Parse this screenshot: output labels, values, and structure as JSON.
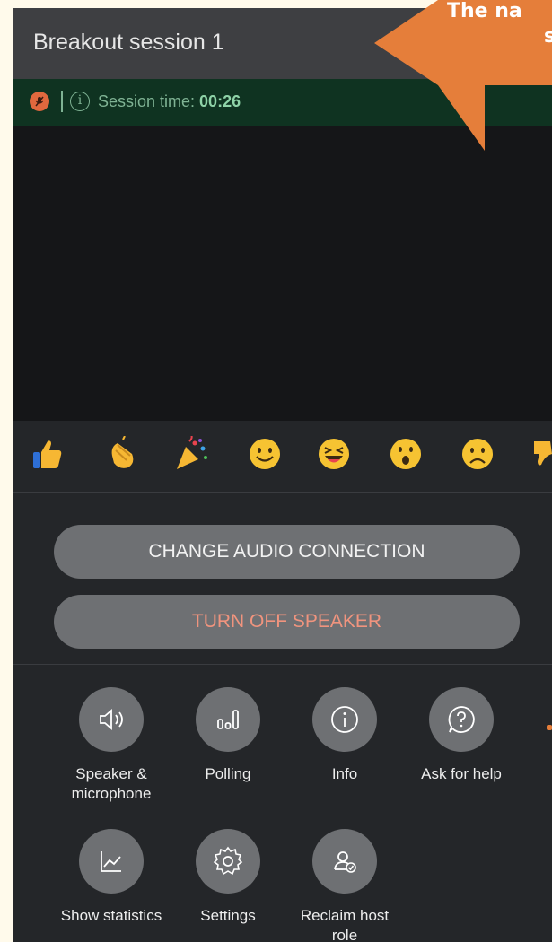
{
  "header": {
    "title": "Breakout session 1"
  },
  "status": {
    "session_label": "Session time: ",
    "session_time": "00:26"
  },
  "reactions": [
    {
      "icon": "thumbs-up-icon"
    },
    {
      "icon": "clapping-hands-icon"
    },
    {
      "icon": "party-popper-icon"
    },
    {
      "icon": "smiling-face-icon"
    },
    {
      "icon": "laughing-face-icon"
    },
    {
      "icon": "surprised-face-icon"
    },
    {
      "icon": "frowning-face-icon"
    },
    {
      "icon": "thumbs-down-icon"
    }
  ],
  "buttons": {
    "change_audio": "CHANGE AUDIO CONNECTION",
    "turn_off_speaker": "TURN OFF SPEAKER"
  },
  "actions": [
    {
      "label": "Speaker & microphone",
      "icon": "speaker-icon"
    },
    {
      "label": "Polling",
      "icon": "poll-chart-icon"
    },
    {
      "label": "Info",
      "icon": "info-icon"
    },
    {
      "label": "Ask for help",
      "icon": "question-bubble-icon"
    },
    {
      "label": "Show statistics",
      "icon": "line-chart-icon"
    },
    {
      "label": "Settings",
      "icon": "gear-icon"
    },
    {
      "label": "Reclaim host role",
      "icon": "user-check-icon"
    }
  ],
  "callout": {
    "line1": "The na",
    "line2": "s"
  },
  "colors": {
    "accent_orange": "#E57E3A",
    "status_green": "#0F3321",
    "speaker_text": "#F0947E",
    "button_gray": "#6E7073"
  }
}
